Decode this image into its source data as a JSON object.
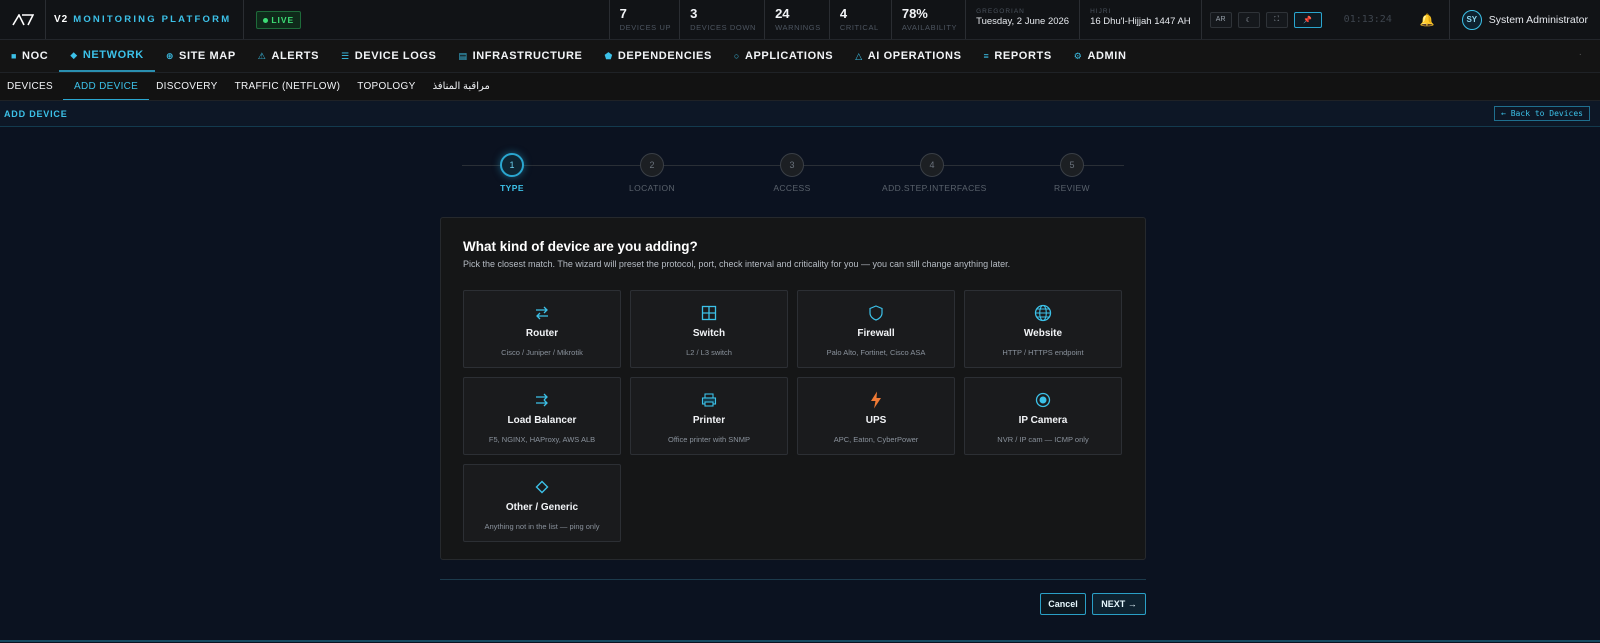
{
  "brand": {
    "prefix": "V2",
    "name": "MONITORING PLATFORM",
    "live": "LIVE"
  },
  "stats": [
    {
      "value": "7",
      "label": "DEVICES UP"
    },
    {
      "value": "3",
      "label": "DEVICES DOWN"
    },
    {
      "value": "24",
      "label": "WARNINGS"
    },
    {
      "value": "4",
      "label": "CRITICAL"
    },
    {
      "value": "78%",
      "label": "AVAILABILITY"
    }
  ],
  "dates": {
    "gregorian_cap": "GREGORIAN",
    "gregorian": "Tuesday, 2 June 2026",
    "hijri_cap": "HIJRI",
    "hijri": "16 Dhu'l-Hijjah 1447 AH"
  },
  "tools": {
    "lang": "AR",
    "theme": "☾",
    "fullscreen": "⛶",
    "pin": "📌"
  },
  "clock": "01:13:24",
  "user": {
    "initials": "SY",
    "name": "System Administrator"
  },
  "mainnav": [
    {
      "icon": "■",
      "label": "NOC"
    },
    {
      "icon": "◆",
      "label": "NETWORK"
    },
    {
      "icon": "⊕",
      "label": "SITE MAP"
    },
    {
      "icon": "⚠",
      "label": "ALERTS"
    },
    {
      "icon": "☰",
      "label": "DEVICE LOGS"
    },
    {
      "icon": "▤",
      "label": "INFRASTRUCTURE"
    },
    {
      "icon": "⬟",
      "label": "DEPENDENCIES"
    },
    {
      "icon": "○",
      "label": "APPLICATIONS"
    },
    {
      "icon": "△",
      "label": "AI OPERATIONS"
    },
    {
      "icon": "≡",
      "label": "REPORTS"
    },
    {
      "icon": "⚙",
      "label": "ADMIN"
    }
  ],
  "subnav": [
    "DEVICES",
    "ADD DEVICE",
    "DISCOVERY",
    "TRAFFIC (NETFLOW)",
    "TOPOLOGY",
    "مراقبة المنافذ"
  ],
  "page": {
    "title": "ADD DEVICE",
    "back": "← Back to Devices"
  },
  "steps": [
    {
      "num": "1",
      "label": "TYPE"
    },
    {
      "num": "2",
      "label": "LOCATION"
    },
    {
      "num": "3",
      "label": "ACCESS"
    },
    {
      "num": "4",
      "label": "ADD.STEP.INTERFACES"
    },
    {
      "num": "5",
      "label": "REVIEW"
    }
  ],
  "card": {
    "title": "What kind of device are you adding?",
    "subtitle": "Pick the closest match. The wizard will preset the protocol, port, check interval and criticality for you — you can still change anything later."
  },
  "devices": [
    {
      "icon": "router-icon",
      "name": "Router",
      "desc": "Cisco / Juniper / Mikrotik"
    },
    {
      "icon": "switch-icon",
      "name": "Switch",
      "desc": "L2 / L3 switch"
    },
    {
      "icon": "shield-icon",
      "name": "Firewall",
      "desc": "Palo Alto, Fortinet, Cisco ASA"
    },
    {
      "icon": "globe-icon",
      "name": "Website",
      "desc": "HTTP / HTTPS endpoint"
    },
    {
      "icon": "balancer-icon",
      "name": "Load Balancer",
      "desc": "F5, NGINX, HAProxy, AWS ALB"
    },
    {
      "icon": "printer-icon",
      "name": "Printer",
      "desc": "Office printer with SNMP"
    },
    {
      "icon": "bolt-icon",
      "name": "UPS",
      "desc": "APC, Eaton, CyberPower"
    },
    {
      "icon": "camera-icon",
      "name": "IP Camera",
      "desc": "NVR / IP cam — ICMP only"
    },
    {
      "icon": "diamond-icon",
      "name": "Other / Generic",
      "desc": "Anything not in the list — ping only"
    }
  ],
  "actions": {
    "cancel": "Cancel",
    "next": "NEXT →"
  },
  "colors": {
    "accent": "#3cc1e8",
    "ups": "#f07a35",
    "live": "#3ddc75"
  }
}
